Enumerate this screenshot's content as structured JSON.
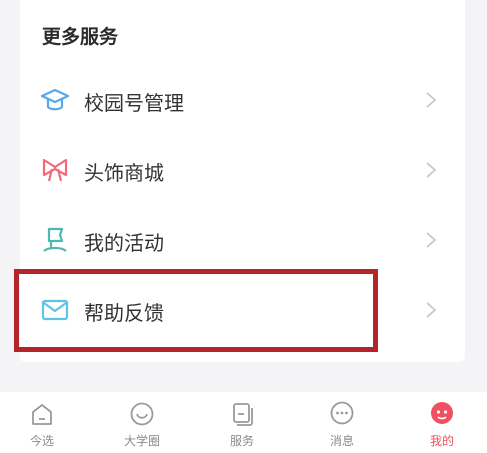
{
  "section": {
    "title": "更多服务"
  },
  "menu": [
    {
      "label": "校园号管理",
      "icon": "mortarboard-icon"
    },
    {
      "label": "头饰商城",
      "icon": "bow-icon"
    },
    {
      "label": "我的活动",
      "icon": "flag-icon"
    },
    {
      "label": "帮助反馈",
      "icon": "envelope-icon"
    }
  ],
  "tabs": [
    {
      "label": "今选",
      "icon": "home-icon",
      "active": false
    },
    {
      "label": "大学圈",
      "icon": "smile-icon",
      "active": false
    },
    {
      "label": "服务",
      "icon": "cards-icon",
      "active": false
    },
    {
      "label": "消息",
      "icon": "chat-bubble-icon",
      "active": false
    },
    {
      "label": "我的",
      "icon": "profile-icon",
      "active": true
    }
  ],
  "colors": {
    "accent": "#f0505f",
    "highlight_border": "#b3242b",
    "icon_blue": "#5aa6e8",
    "icon_pink": "#f26b7c",
    "icon_teal": "#4fb9b0",
    "icon_sky": "#5bc4e8"
  }
}
